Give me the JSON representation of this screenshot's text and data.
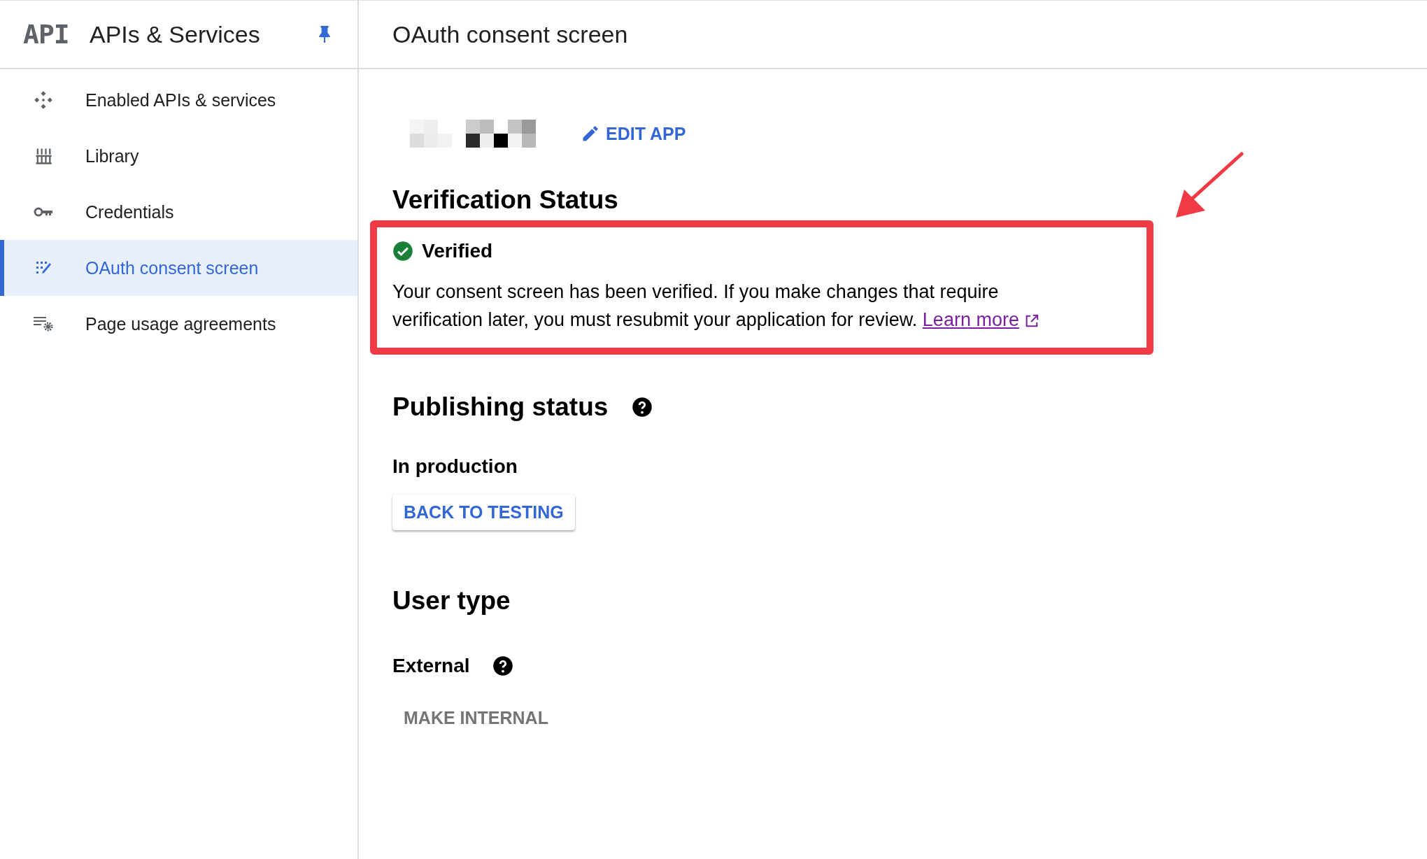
{
  "sidebar": {
    "logo": "API",
    "title": "APIs & Services",
    "pinned": true,
    "items": [
      {
        "label": "Enabled APIs & services",
        "selected": false
      },
      {
        "label": "Library",
        "selected": false
      },
      {
        "label": "Credentials",
        "selected": false
      },
      {
        "label": "OAuth consent screen",
        "selected": true
      },
      {
        "label": "Page usage agreements",
        "selected": false
      }
    ]
  },
  "page": {
    "title": "OAuth consent screen"
  },
  "app": {
    "edit_label": "EDIT APP"
  },
  "verification": {
    "heading": "Verification Status",
    "highlighted": true,
    "verified": true,
    "status": "Verified",
    "message": "Your consent screen has been verified. If you make changes that require verification later, you must resubmit your application for review.",
    "link": "Learn more"
  },
  "publishing": {
    "heading": "Publishing status",
    "status": "In production",
    "button": "BACK TO TESTING"
  },
  "user_type": {
    "heading": "User type",
    "value": "External",
    "button": "MAKE INTERNAL"
  }
}
